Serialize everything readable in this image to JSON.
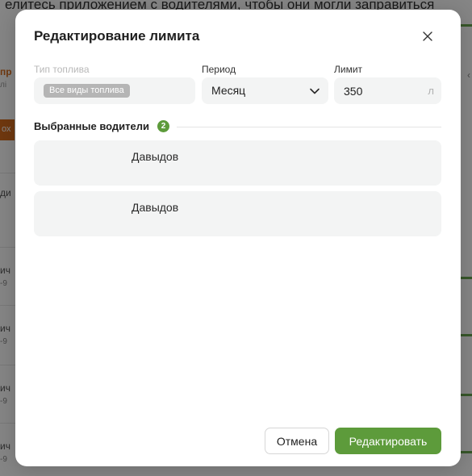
{
  "background": {
    "top_text": "елитесь приложением с водителями, чтобы они могли заправиться",
    "left_fragments": {
      "orange_text": "пр",
      "gray_text": "лі",
      "button_text": "ох",
      "label_1": "ди",
      "rows": [
        {
          "label": "ич",
          "sub": "-9"
        },
        {
          "label": "ич",
          "sub": "-9"
        },
        {
          "label": "ич",
          "sub": "-9"
        },
        {
          "label": "ич",
          "sub": "-9"
        }
      ]
    },
    "right_chevron": "‹"
  },
  "modal": {
    "title": "Редактирование лимита",
    "close_icon": "close-icon",
    "fields": {
      "fuel_type": {
        "label": "Тип топлива",
        "chip": "Все виды топлива"
      },
      "period": {
        "label": "Период",
        "value": "Месяц"
      },
      "limit": {
        "label": "Лимит",
        "value": "350",
        "unit": "л"
      }
    },
    "selected_drivers": {
      "title": "Выбранные водители",
      "count": "2",
      "items": [
        {
          "name": "Давыдов"
        },
        {
          "name": "Давыдов"
        }
      ]
    },
    "buttons": {
      "cancel": "Отмена",
      "submit": "Редактировать"
    }
  },
  "colors": {
    "accent": "#5d9b3b",
    "overlay": "rgba(0,0,0,0.48)",
    "field_bg": "#f3f4f4"
  }
}
